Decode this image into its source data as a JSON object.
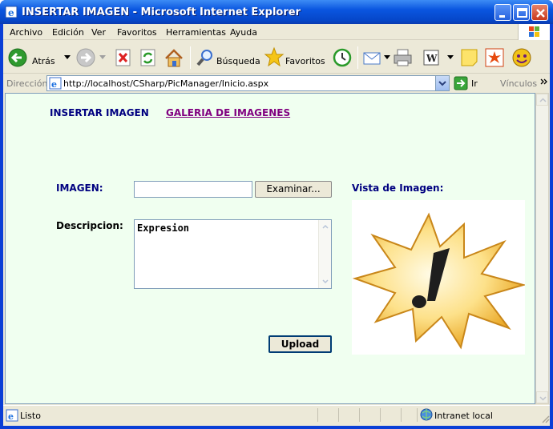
{
  "window": {
    "title": "INSERTAR IMAGEN - Microsoft Internet Explorer"
  },
  "menu": [
    "Archivo",
    "Edición",
    "Ver",
    "Favoritos",
    "Herramientas",
    "Ayuda"
  ],
  "toolbar": {
    "back_label": "Atrás",
    "search_label": "Búsqueda",
    "favorites_label": "Favoritos"
  },
  "address": {
    "label": "Dirección",
    "url": "http://localhost/CSharp/PicManager/Inicio.aspx",
    "go_label": "Ir",
    "links_label": "Vínculos"
  },
  "page": {
    "nav_insert": "INSERTAR IMAGEN",
    "nav_gallery": "GALERIA DE IMAGENES",
    "image_label": "IMAGEN:",
    "browse_button": "Examinar...",
    "preview_label": "Vista de Imagen:",
    "description_label": "Descripcion:",
    "description_value": "Expresion",
    "upload_button": "Upload"
  },
  "status": {
    "text": "Listo",
    "zone": "Intranet local"
  },
  "colors": {
    "nav_active": "#000080",
    "nav_link": "#800080",
    "content_bg": "#f0fff0"
  }
}
